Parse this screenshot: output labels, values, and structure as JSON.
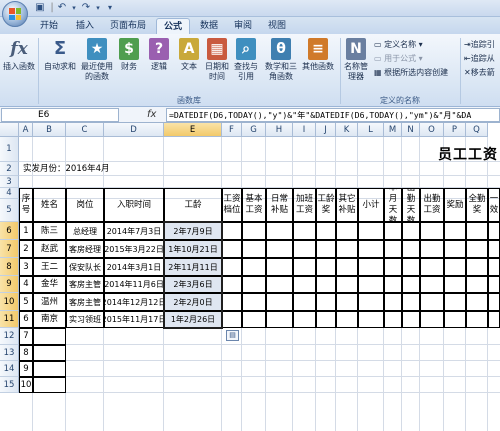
{
  "titlebar": {
    "undo_icon": "undo-icon",
    "redo_icon": "redo-icon",
    "save_icon": "save-icon",
    "customize": "▾"
  },
  "tabs": [
    "开始",
    "插入",
    "页面布局",
    "公式",
    "数据",
    "审阅",
    "视图"
  ],
  "active_tab": "公式",
  "ribbon": {
    "buttons": [
      {
        "label": "插入函数",
        "glyph": "fx",
        "color": "#4a5d7a"
      },
      {
        "label": "自动求和",
        "glyph": "Σ",
        "color": "#3a5a8a"
      },
      {
        "label": "最近使用的函数",
        "glyph": "★",
        "color": "#3f8fbf"
      },
      {
        "label": "财务",
        "glyph": "$",
        "color": "#4f9e4f"
      },
      {
        "label": "逻辑",
        "glyph": "?",
        "color": "#9a5fb0"
      },
      {
        "label": "文本",
        "glyph": "A",
        "color": "#c9a93a"
      },
      {
        "label": "日期和时间",
        "glyph": "▦",
        "color": "#c95a3f"
      },
      {
        "label": "查找与引用",
        "glyph": "⌕",
        "color": "#3f8fbf"
      },
      {
        "label": "数学和三角函数",
        "glyph": "θ",
        "color": "#3f7fb0"
      },
      {
        "label": "其他函数",
        "glyph": "≡",
        "color": "#d07a2a"
      },
      {
        "label": "名称管理器",
        "glyph": "N",
        "color": "#6a7fa0"
      }
    ],
    "group_function_library": "函数库",
    "group_defined_names": "定义的名称",
    "define_name": "定义名称 ▾",
    "use_in_formula": "用于公式 ▾",
    "create_from_selection": "根据所选内容创建",
    "trace_precedents": "追踪引",
    "trace_dependents": "追踪从",
    "remove_arrows": "移去箭"
  },
  "formula_bar": {
    "name_box": "E6",
    "fx": "fx",
    "formula": "=DATEDIF(D6,TODAY(),\"y\")&\"年\"&DATEDIF(D6,TODAY(),\"ym\")&\"月\"&DA"
  },
  "columns": [
    "A",
    "B",
    "C",
    "D",
    "E",
    "F",
    "G",
    "H",
    "I",
    "J",
    "K",
    "L",
    "M",
    "N",
    "O",
    "P",
    "Q"
  ],
  "rows": [
    "1",
    "2",
    "3",
    "4",
    "5",
    "6",
    "7",
    "8",
    "9",
    "10",
    "11",
    "12",
    "13",
    "14",
    "15"
  ],
  "selected_column": "E",
  "selected_rows": [
    "6",
    "7",
    "8",
    "9",
    "10",
    "11"
  ],
  "sheet": {
    "title": "员工工资",
    "pay_month": "实发月份：2016年4月",
    "headers": {
      "seq": "序号",
      "name": "姓名",
      "position": "岗位",
      "hire_date": "入职时间",
      "seniority": "工龄",
      "base_grade": "工资档位",
      "base_pay": "基本工资",
      "allowance": "日常补贴",
      "overtime": "加班工资",
      "seniority_pay": "工龄奖",
      "other_allowance": "其它补贴",
      "subtotal": "小计",
      "month_days": "本月天数",
      "attendance_days": "出勤天数",
      "attendance_pay": "出勤工资",
      "bonus": "奖励",
      "full_attendance": "全勤奖",
      "extra": "一效"
    },
    "employees": [
      {
        "seq": "1",
        "name": "陈三",
        "position": "总经理",
        "hire_date": "2014年7月3日",
        "seniority": "2年7月9日"
      },
      {
        "seq": "2",
        "name": "赵武",
        "position": "客房经理",
        "hire_date": "2015年3月22日",
        "seniority": "1年10月21日"
      },
      {
        "seq": "3",
        "name": "王二",
        "position": "保安队长",
        "hire_date": "2014年3月1日",
        "seniority": "2年11月11日"
      },
      {
        "seq": "4",
        "name": "金华",
        "position": "客房主管",
        "hire_date": "2014年11月6日",
        "seniority": "2年3月6日"
      },
      {
        "seq": "5",
        "name": "温州",
        "position": "客房主管",
        "hire_date": "2014年12月12日",
        "seniority": "2年2月0日"
      },
      {
        "seq": "6",
        "name": "南京",
        "position": "实习领班",
        "hire_date": "2015年11月17日",
        "seniority": "1年2月26日"
      }
    ],
    "empty_seq": [
      "7",
      "8",
      "9",
      "10"
    ]
  },
  "paste_options_icon": "paste-options-icon"
}
